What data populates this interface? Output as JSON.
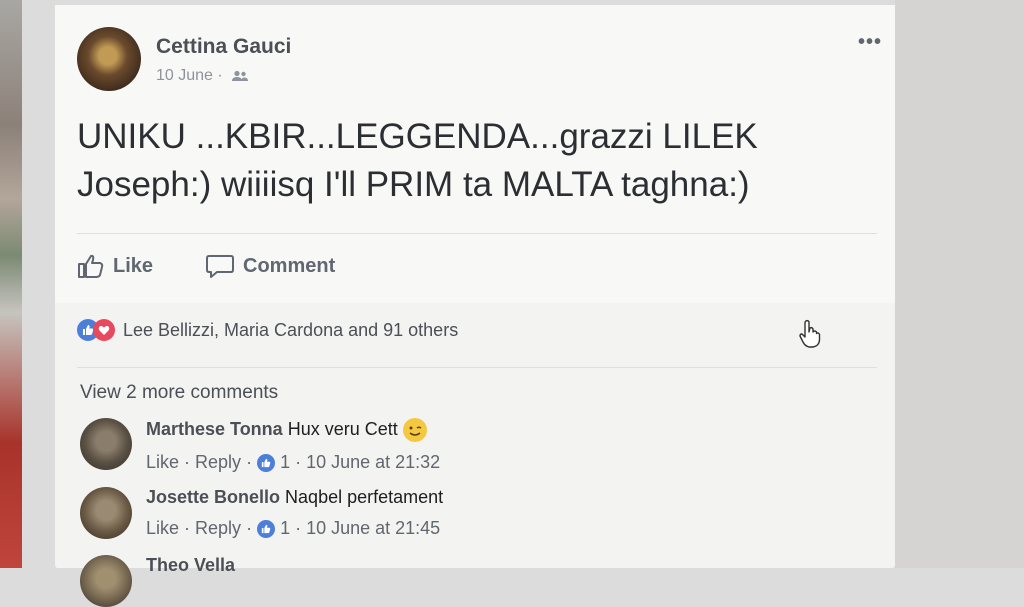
{
  "post": {
    "author_name": "Cettina Gauci",
    "date": "10 June",
    "meta_separator": "·",
    "audience_icon": "friends-icon",
    "more_icon": "•••",
    "text_line1": "UNIKU ...KBIR...LEGGENDA...grazzi LILEK",
    "text_line2": "Joseph:) wiiiisq I'll PRIM ta MALTA taghna:)"
  },
  "actions": {
    "like_label": "Like",
    "comment_label": "Comment"
  },
  "reactions": {
    "summary": "Lee Bellizzi, Maria Cardona and 91 others"
  },
  "comments_section": {
    "view_more": "View 2 more comments",
    "comments": [
      {
        "author": "Marthese Tonna",
        "text": "Hux veru Cett",
        "has_emoji": true,
        "like": "Like",
        "reply": "Reply",
        "like_count": "1",
        "timestamp": "10 June at 21:32"
      },
      {
        "author": "Josette Bonello",
        "text": "Naqbel perfetament",
        "has_emoji": false,
        "like": "Like",
        "reply": "Reply",
        "like_count": "1",
        "timestamp": "10 June at 21:45"
      },
      {
        "author": "Theo Vella",
        "text": "",
        "has_emoji": false
      }
    ]
  },
  "colors": {
    "like_blue": "#4d7fd8",
    "love_red": "#e8495e",
    "text_gray": "#606770"
  }
}
